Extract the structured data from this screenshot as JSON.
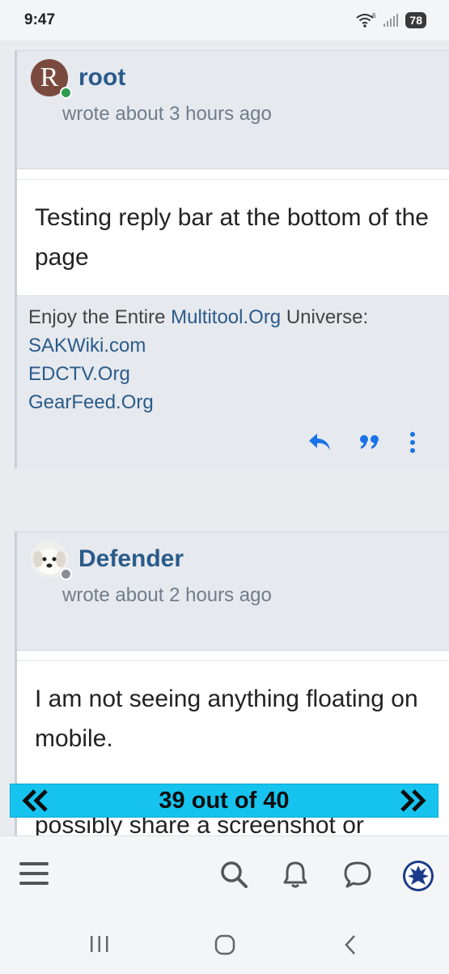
{
  "status_bar": {
    "time": "9:47",
    "battery": "78",
    "signal_label": "6"
  },
  "posts": [
    {
      "avatar_letter": "R",
      "username": "root",
      "timestamp": "wrote about 3 hours ago",
      "body": "Testing reply bar at the bottom of the page",
      "signature": {
        "intro_text": "Enjoy the Entire ",
        "intro_link": "Multitool.Org",
        "intro_suffix": " Universe:",
        "links": [
          "SAKWiki.com",
          "EDCTV.Org",
          "GearFeed.Org"
        ]
      },
      "presence_color": "#2e9d4f"
    },
    {
      "username": "Defender",
      "timestamp": "wrote about 2 hours ago",
      "body_line1": "I am not seeing anything floating on mobile.",
      "body_line2_partial": "possibly share a screenshot or",
      "presence_color": "#8a8f96"
    }
  ],
  "pager": {
    "text": "39 out of 40",
    "prev_icon": "double-chevron-left",
    "next_icon": "double-chevron-right"
  },
  "toolbar": {
    "menu_icon": "hamburger-icon",
    "search_icon": "search-icon",
    "notifications_icon": "bell-icon",
    "chat_icon": "chat-icon",
    "profile_icon": "user-avatar"
  },
  "colors": {
    "accent": "#2a5b8a",
    "action_blue": "#1a73e8",
    "pager": "#16c3ef"
  }
}
